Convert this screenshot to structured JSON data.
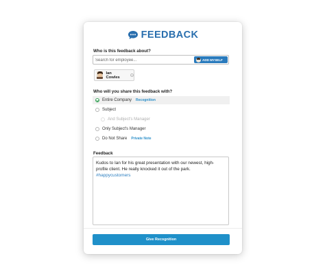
{
  "header": {
    "icon": "speech-bubble-icon",
    "title": "FEEDBACK",
    "accent_color": "#2a6fae"
  },
  "about": {
    "label": "Who is this feedback about?",
    "search_placeholder": "Search for employee...",
    "add_myself_label": "ADD MYSELF",
    "selected_employee": {
      "name": "Ian Cowles",
      "remove_icon": "close-circle-icon"
    }
  },
  "share": {
    "label": "Who will you share this feedback with?",
    "options": [
      {
        "label": "Entire Company",
        "tag": "Recognition",
        "checked": true,
        "disabled": false
      },
      {
        "label": "Subject",
        "tag": "",
        "checked": false,
        "disabled": false
      },
      {
        "label": "And Subject's Manager",
        "tag": "",
        "checked": false,
        "disabled": true
      },
      {
        "label": "Only Subject's Manager",
        "tag": "",
        "checked": false,
        "disabled": false
      },
      {
        "label": "Do Not Share",
        "tag": "Private Note",
        "checked": false,
        "disabled": false
      }
    ]
  },
  "feedback": {
    "label": "Feedback",
    "text": "Kudos to Ian for his great presentation with our newest, high-profile client. He really knocked it out of the park.",
    "hashtag": "#happycustomers"
  },
  "submit": {
    "label": "Give Recognition",
    "color": "#1f90c9"
  }
}
